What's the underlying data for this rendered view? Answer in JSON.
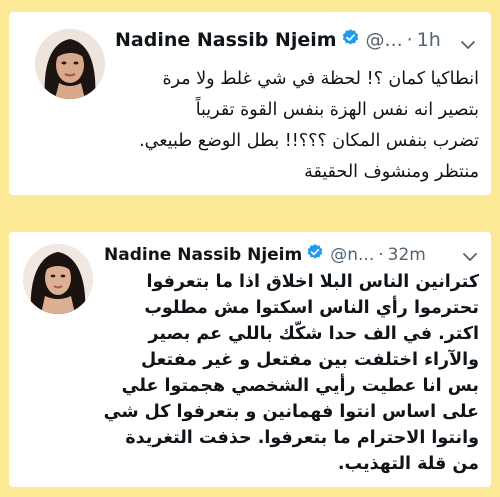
{
  "tweets": [
    {
      "author": "Nadine Nassib Njeim",
      "handle": "@...",
      "separator": "·",
      "time": "1h",
      "text": "انطاكيا كمان ؟! لحظة في شي غلط ولا مرة\nبتصير انه نفس الهزة بنفس القوة تقريباً\nتضرب بنفس المكان ؟؟؟!! بطل الوضع طبيعي.\nمنتظر ومنشوف الحقيقة"
    },
    {
      "author": "Nadine Nassib Njeim",
      "handle": "@n...",
      "separator": "·",
      "time": "32m",
      "text": "كترانين الناس البلا اخلاق اذا ما بتعرفوا\nتحترموا رأي الناس اسكتوا مش مطلوب\nاكتر. في الف حدا شكّك باللي عم بصير\nوالآراء اختلفت بين مفتعل و غير مفتعل\nبس انا عطيت رأيي الشخصي هجمتوا علي\nعلى اساس انتوا فهمانين و بتعرفوا كل شي\nوانتوا الاحترام ما بتعرفوا. حذفت التغريدة\nمن قلة التهذيب."
    }
  ],
  "colors": {
    "background": "#fce995",
    "card": "#ffffff",
    "verified_badge": "#1d9bf0",
    "muted_text": "#536471"
  },
  "icons": [
    "avatar-image",
    "verified-badge-icon",
    "chevron-down-icon"
  ]
}
